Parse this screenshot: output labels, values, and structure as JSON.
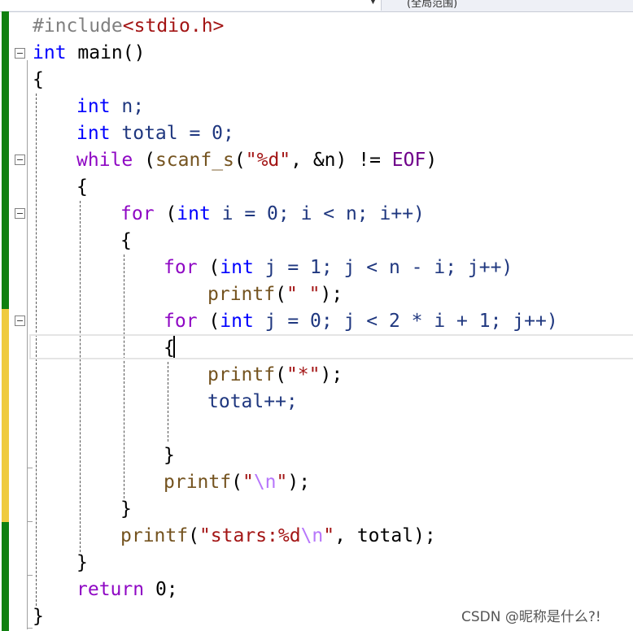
{
  "toolbar": {
    "scope_label": "(全局范围)"
  },
  "code": {
    "l1": [
      "#include",
      "<stdio.h>"
    ],
    "l2": [
      "int",
      " main()"
    ],
    "l3": "{",
    "l4": [
      "int",
      " n;"
    ],
    "l5": [
      "int",
      " total = 0;"
    ],
    "l6": [
      "while",
      " (",
      "scanf_s",
      "(",
      "\"%d\"",
      ", &n) != ",
      "EOF",
      ")"
    ],
    "l7": "{",
    "l8": [
      "for",
      " (",
      "int",
      " i = 0; i < n; i++)"
    ],
    "l9": "{",
    "l10": [
      "for",
      " (",
      "int",
      " j = 1; j < n - i; j++)"
    ],
    "l11": [
      "printf",
      "(",
      "\" \"",
      ");"
    ],
    "l12": [
      "for",
      " (",
      "int",
      " j = 0; j < 2 * i + 1; j++)"
    ],
    "l13": "{",
    "l14": [
      "printf",
      "(",
      "\"*\"",
      ");"
    ],
    "l15": "total++;",
    "l16": "}",
    "l17": [
      "printf",
      "(",
      "\"",
      "\\n",
      "\"",
      ");"
    ],
    "l18": "}",
    "l19": [
      "printf",
      "(",
      "\"stars:%d",
      "\\n",
      "\"",
      ", total);"
    ],
    "l20": "}",
    "l21": [
      "return",
      " 0;"
    ],
    "l22": "}"
  },
  "watermark": "CSDN @昵称是什么?!",
  "colors": {
    "keyword": "#0000ff",
    "control": "#8f08c4",
    "string": "#a31515",
    "escape": "#b776fb",
    "macro": "#6f008a",
    "change_saved": "#108010",
    "change_unsaved": "#efcb3f"
  }
}
